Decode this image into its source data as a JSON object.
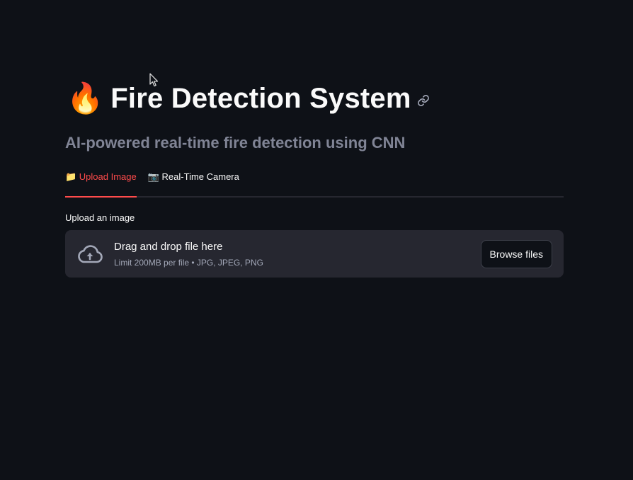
{
  "header": {
    "emoji": "🔥",
    "title": "Fire Detection System",
    "subtitle": "AI-powered real-time fire detection using CNN"
  },
  "tabs": [
    {
      "label": "📁 Upload Image",
      "active": true
    },
    {
      "label": "📷 Real-Time Camera",
      "active": false
    }
  ],
  "uploader": {
    "label": "Upload an image",
    "drop_text": "Drag and drop file here",
    "limit_text": "Limit 200MB per file • JPG, JPEG, PNG",
    "browse_label": "Browse files"
  },
  "colors": {
    "background": "#0e1117",
    "accent": "#ff4b4b",
    "dropzone": "#262730",
    "muted": "#808495"
  },
  "icons": [
    "fire-emoji",
    "link-icon",
    "cloud-upload-icon",
    "mouse-cursor-icon"
  ]
}
